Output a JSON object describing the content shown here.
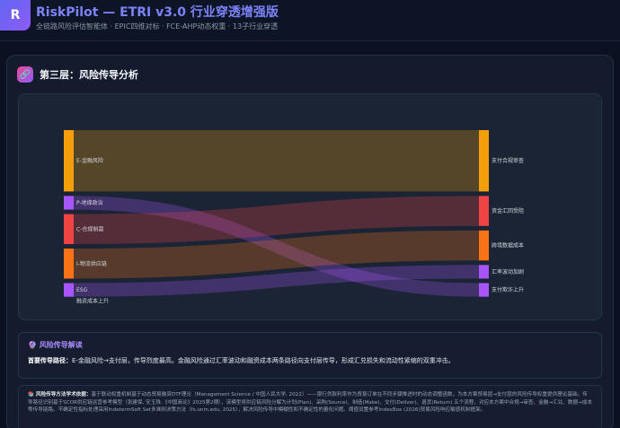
{
  "app": {
    "logo_letter": "R",
    "title": "RiskPilot — ETRI v3.0 行业穿透增强版",
    "subtitle": "全链路风险评估智能体 · EPIC四维对标 · FCE-AHP动态权重 · 13子行业穿透"
  },
  "section": {
    "icon": "link-icon",
    "title": "第三层：风险传导分析"
  },
  "chart_data": {
    "type": "sankey",
    "sources": [
      {
        "name": "E-金融风险",
        "color": "#f59e0b",
        "value": 45
      },
      {
        "name": "P-地缘政治",
        "color": "#a855f7",
        "value": 10
      },
      {
        "name": "C-合规制裁",
        "color": "#ef4444",
        "value": 22
      },
      {
        "name": "I-物流供应链",
        "color": "#f97316",
        "value": 22
      },
      {
        "name": "ESG",
        "color": "#a855f7",
        "value": 10
      }
    ],
    "targets": [
      {
        "name": "支付合规审查",
        "color": "#f59e0b",
        "value": 45
      },
      {
        "name": "资金汇回受阻",
        "color": "#ef4444",
        "value": 22
      },
      {
        "name": "跨境数据成本",
        "color": "#f97316",
        "value": 22
      },
      {
        "name": "汇率波动加剧",
        "color": "#a855f7",
        "value": 10
      },
      {
        "name": "支付欺诈上升",
        "color": "#a855f7",
        "value": 10
      }
    ],
    "links": [
      {
        "source": 0,
        "target": 0,
        "value": 45,
        "color": "#f59e0b"
      },
      {
        "source": 1,
        "target": 4,
        "value": 10,
        "color": "#a855f7"
      },
      {
        "source": 2,
        "target": 1,
        "value": 22,
        "color": "#ef4444"
      },
      {
        "source": 3,
        "target": 2,
        "value": 22,
        "color": "#f97316"
      },
      {
        "source": 4,
        "target": 3,
        "value": 10,
        "color": "#a855f7"
      }
    ],
    "extra_label": "融资成本上升"
  },
  "interpretation": {
    "title": "🔮 风险传导解读",
    "lead": "首要传导路径：",
    "text": "E-金融风险→支付层，传导烈度最高。金融风险通过汇率波动和融资成本两条路径向支付层传导，形成汇兑损失和流动性紧缩的双重冲击。"
  },
  "theory": {
    "lead": "📚 风险传导方法学术依据：",
    "text": "基于联动权重机制基于动态贸易融资DTF理论（Management Science / 中国人民大学, 2022）——银行贷款利率作为贸易订单在不同步骤推进时的动态调整函数，为本方案贸易层→支付层的风险传导权重提供理论基础。传导路径识别基于SCOR供应链运营参考模型（张建保, 安玉珠.《中国商论》2025第2期），该模型将供应链风险分解为计划(Plan)、采购(Source)、制造(Make)、交付(Deliver)、退货(Return) 五个流程，对应本方案中合规→审查、金融→汇兑、数据→成本等传导链路。不确定性指标处理采用IndetermSoft Set多准则决策方法（fs.unm.edu, 2025），解决风险传导中模糊性和不确定性的量化问题。阈值设置参考IndexBox (2026)贸易风险响应敏感机制框架。"
  }
}
